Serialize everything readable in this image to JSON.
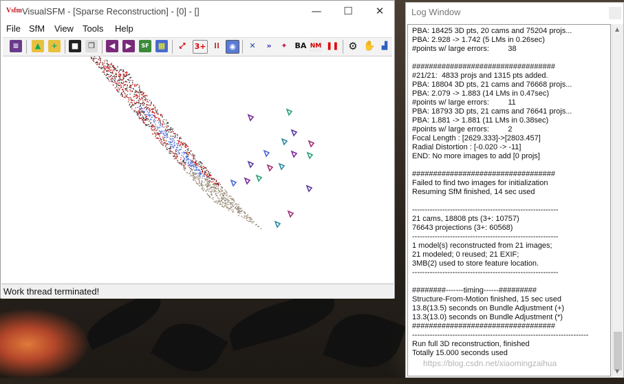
{
  "window": {
    "title": "VisualSFM - [Sparse Reconstruction] - [0] - []",
    "logo": "V",
    "logo_mark": "sfm",
    "minimize": "—",
    "maximize": "☐",
    "close": "✕"
  },
  "menu": {
    "file": "File",
    "sfm": "SfM",
    "view": "View",
    "tools": "Tools",
    "help": "Help"
  },
  "toolbar": {
    "label_3plus": "3+",
    "label_ba": "BA",
    "label_nm": "NM"
  },
  "status": {
    "text": "Work thread terminated!"
  },
  "log": {
    "title": "Log Window",
    "lines": [
      "PBA: 18425 3D pts, 20 cams and 75204 projs...",
      "PBA: 2.928 -> 1.742 (5 LMs in 0.26sec)",
      "#points w/ large errors:         38",
      "",
      "##################################",
      "#21/21:  4833 projs and 1315 pts added.",
      "PBA: 18804 3D pts, 21 cams and 76668 projs...",
      "PBA: 2.079 -> 1.883 (14 LMs in 0.47sec)",
      "#points w/ large errors:         11",
      "PBA: 18793 3D pts, 21 cams and 76641 projs...",
      "PBA: 1.881 -> 1.881 (11 LMs in 0.38sec)",
      "#points w/ large errors:         2",
      "Focal Length : [2629.333]->[2803.457]",
      "Radial Distortion : [-0.020 -> -11]",
      "END: No more images to add [0 projs]",
      "",
      "##################################",
      "Failed to find two images for initialization",
      "Resuming SfM finished, 14 sec used",
      "",
      "----------------------------------------------------------",
      "21 cams, 18808 pts (3+: 10757)",
      "76643 projections (3+: 60568)",
      "----------------------------------------------------------",
      "1 model(s) reconstructed from 21 images;",
      "21 modeled; 0 reused; 21 EXIF;",
      "3MB(2) used to store feature location.",
      "----------------------------------------------------------",
      "",
      "########-------timing------#########",
      "Structure-From-Motion finished, 15 sec used",
      "13.8(13.5) seconds on Bundle Adjustment (+)",
      "13.3(13.0) seconds on Bundle Adjustment (*)",
      "##################################",
      "----------------------------------------------------------------------",
      "Run full 3D reconstruction, finished",
      "Totally 15.000 seconds used"
    ]
  },
  "watermark": "https://blog.csdn.net/xiaomingzaihua"
}
